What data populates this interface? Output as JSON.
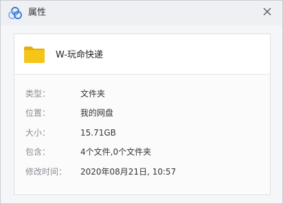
{
  "window": {
    "title": "属性",
    "icons": {
      "app": "cloud-logo-icon",
      "close": "close-icon",
      "folder": "folder-icon"
    }
  },
  "file": {
    "name": "W-玩命快递"
  },
  "properties": [
    {
      "label": "类型：",
      "value": "文件夹"
    },
    {
      "label": "位置：",
      "value": "我的网盘"
    },
    {
      "label": "大小：",
      "value": "15.71GB"
    },
    {
      "label": "包含：",
      "value": "4个文件,0个文件夹"
    },
    {
      "label": "修改时间：",
      "value": "2020年08月21日, 10:57"
    }
  ],
  "colors": {
    "folder": "#f5c518",
    "folder_tab": "#e2ad0e",
    "logo_blue": "#3d7bd9",
    "logo_light": "#8fb6ee"
  }
}
